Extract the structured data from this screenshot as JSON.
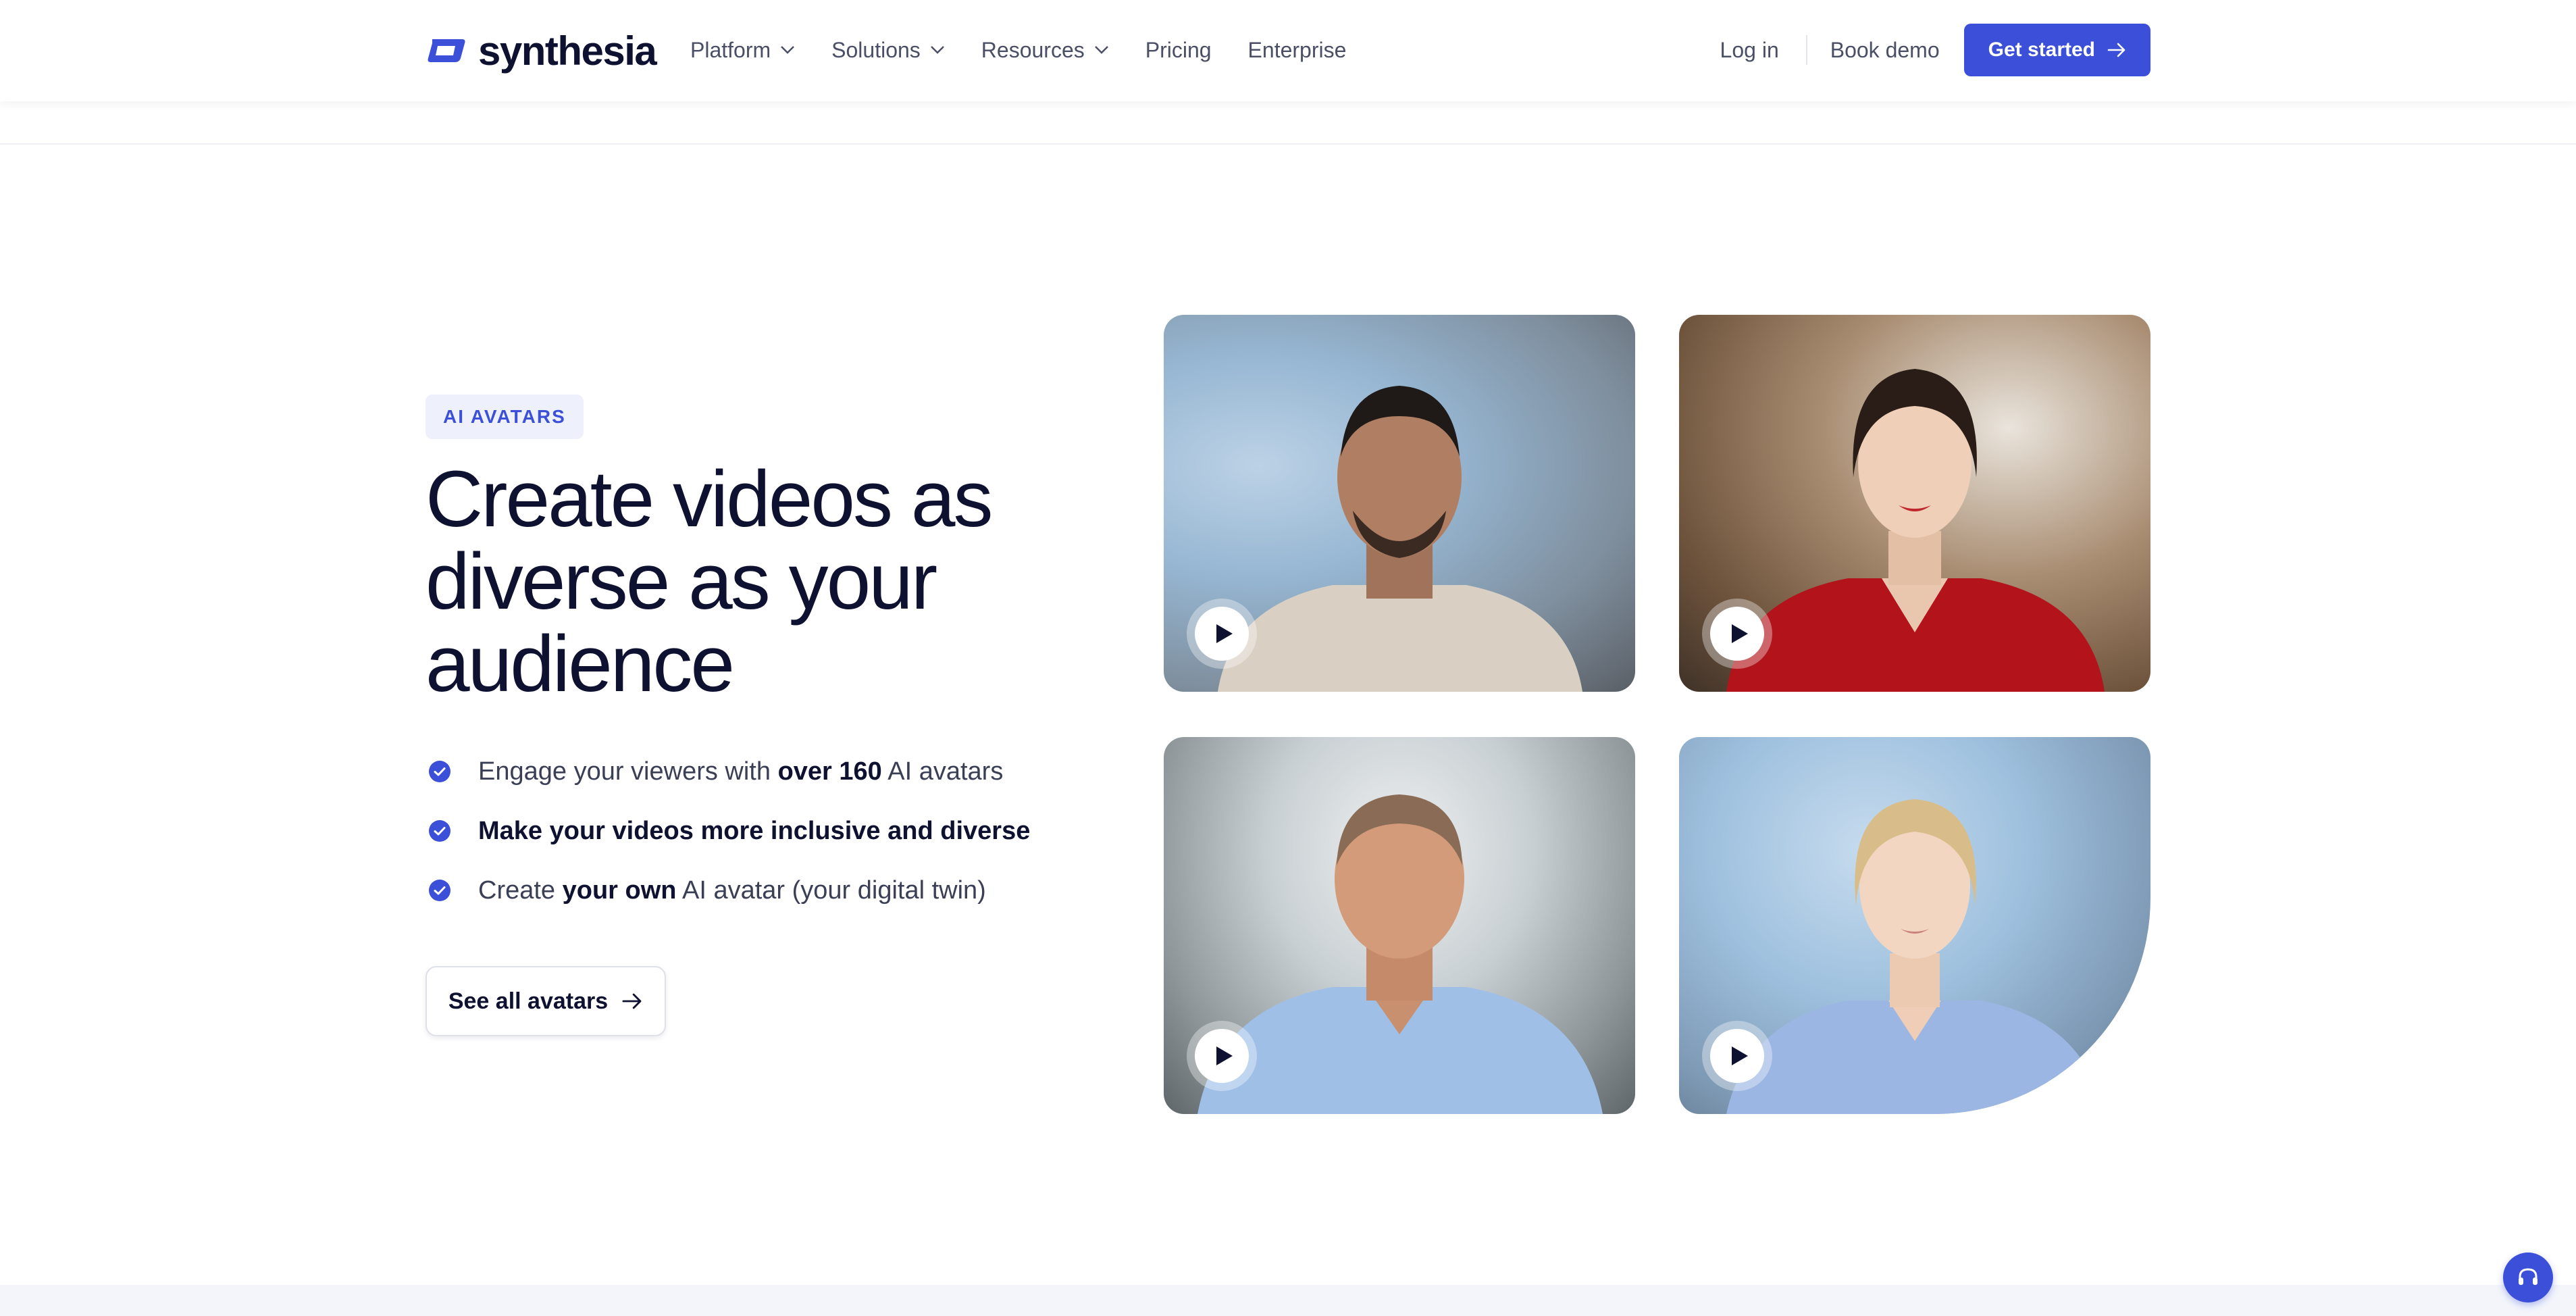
{
  "header": {
    "logo_text": "synthesia",
    "nav": [
      {
        "label": "Platform",
        "has_dropdown": true
      },
      {
        "label": "Solutions",
        "has_dropdown": true
      },
      {
        "label": "Resources",
        "has_dropdown": true
      },
      {
        "label": "Pricing",
        "has_dropdown": false
      },
      {
        "label": "Enterprise",
        "has_dropdown": false
      }
    ],
    "login_label": "Log in",
    "book_demo_label": "Book demo",
    "get_started_label": "Get started"
  },
  "hero": {
    "badge": "AI AVATARS",
    "headline": "Create videos as diverse as your audience",
    "bullets": [
      {
        "before": "Engage your viewers with ",
        "bold": "over 160",
        "after": " AI avatars"
      },
      {
        "before": "",
        "bold": "Make your videos more inclusive and diverse",
        "after": ""
      },
      {
        "before": "Create ",
        "bold": "your own",
        "after": " AI avatar (your digital twin)"
      }
    ],
    "cta_label": "See all avatars"
  },
  "avatars": [
    {
      "icon": "play-icon"
    },
    {
      "icon": "play-icon"
    },
    {
      "icon": "play-icon"
    },
    {
      "icon": "play-icon"
    }
  ],
  "colors": {
    "accent": "#3b4fd8",
    "text_dark": "#0f1130",
    "text_muted": "#4a4f66",
    "badge_bg": "#eef1fb"
  },
  "icons": {
    "logo": "synthesia-logo-icon",
    "dropdown": "chevron-down-icon",
    "arrow": "arrow-right-icon",
    "check": "check-circle-icon",
    "play": "play-icon",
    "help": "headset-icon"
  }
}
